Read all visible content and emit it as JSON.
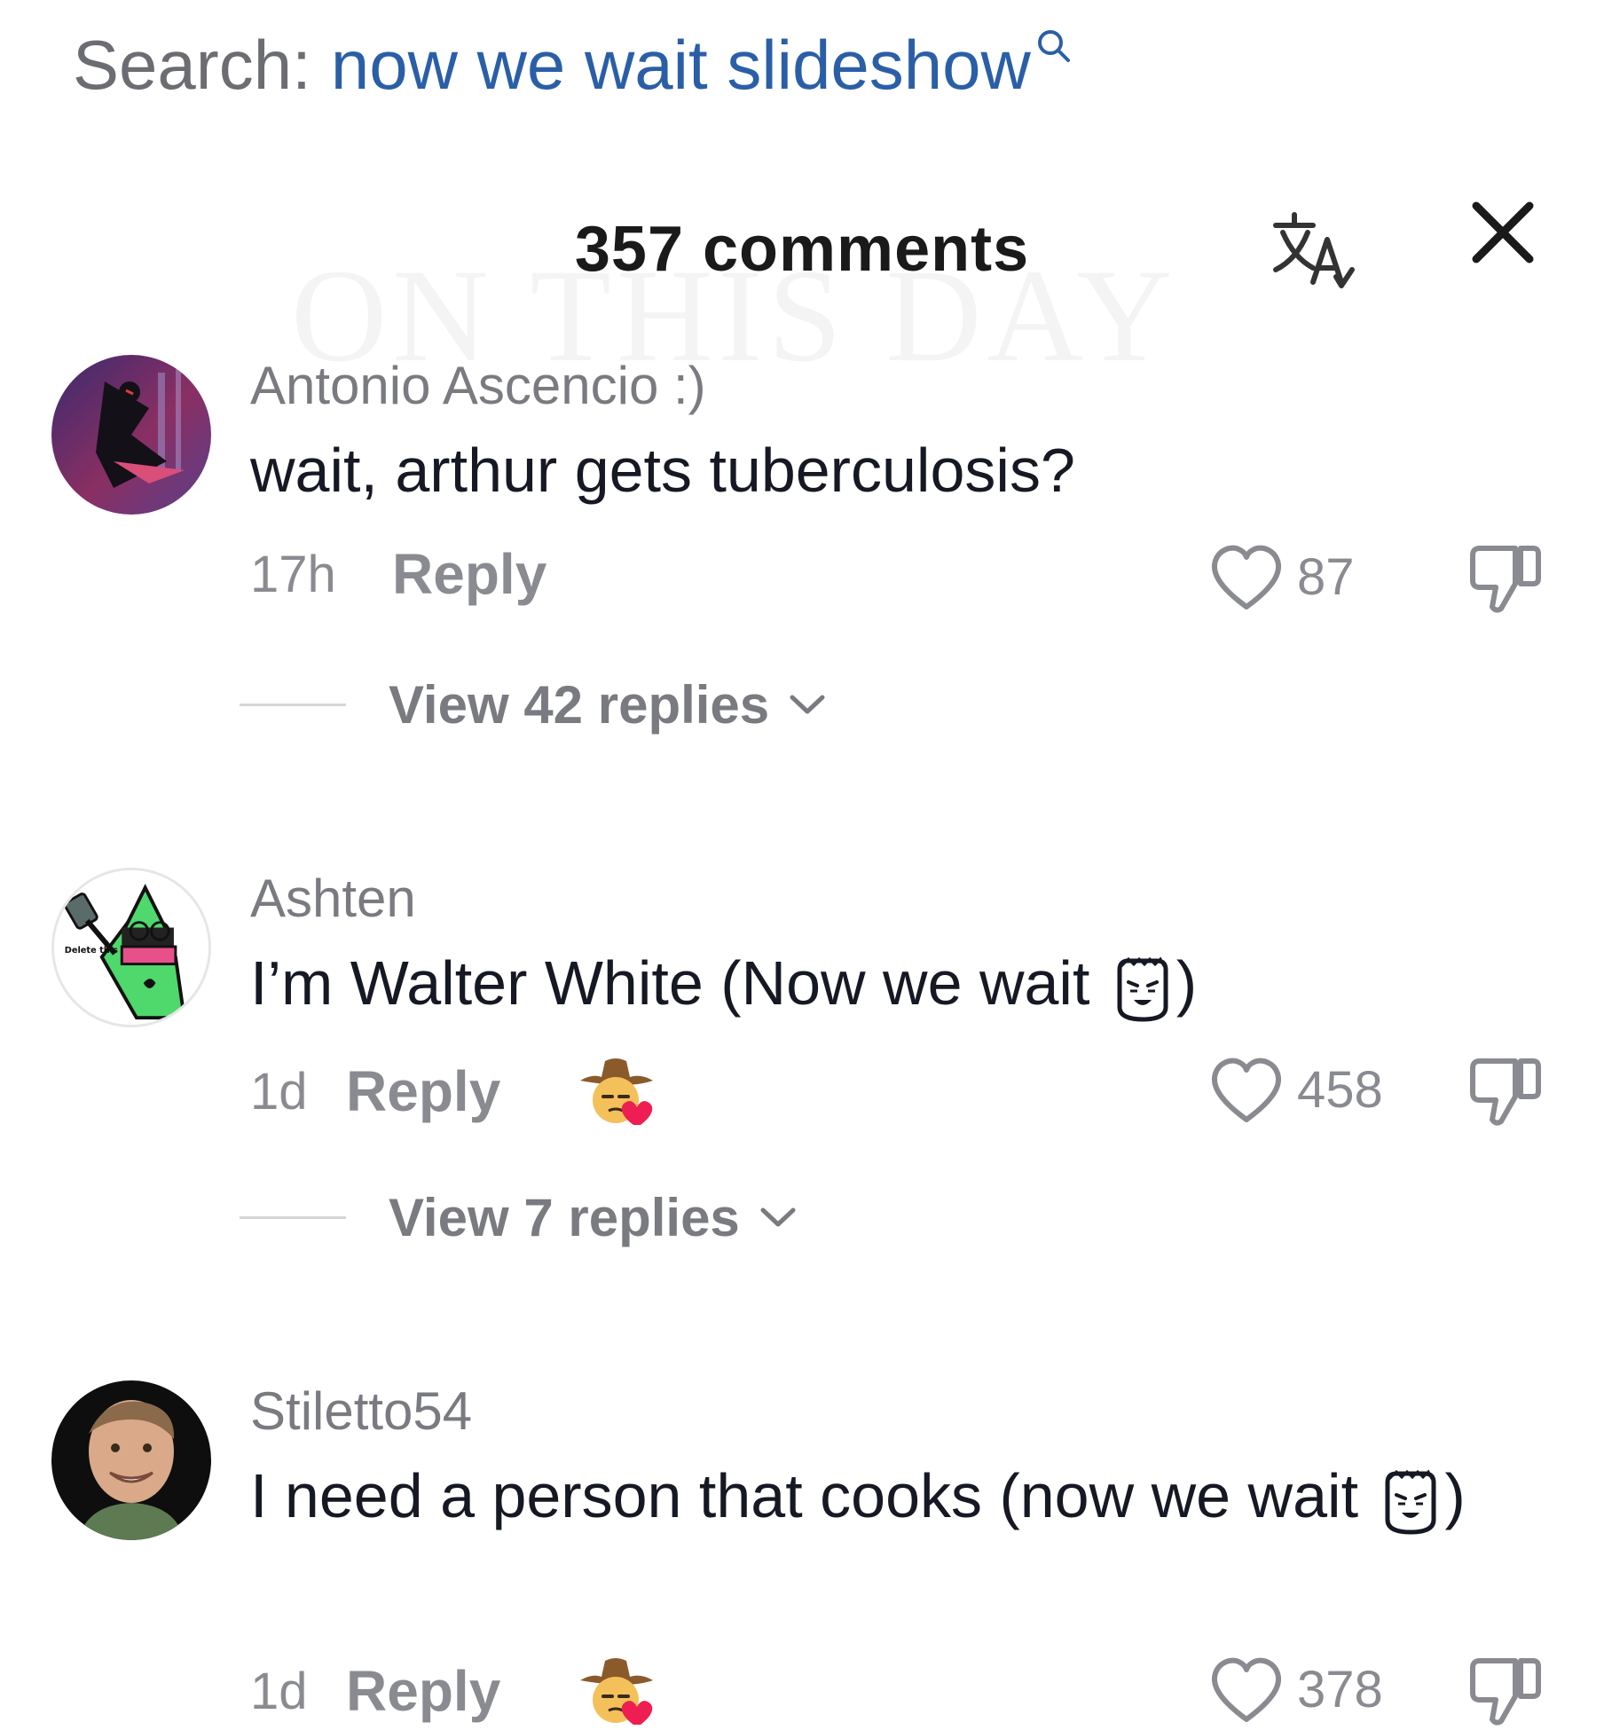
{
  "search": {
    "label": "Search:",
    "query": "now we wait slideshow"
  },
  "header": {
    "comment_count": "357 comments"
  },
  "watermark": "ON THIS DAY",
  "comments": [
    {
      "username": "Antonio Ascencio :)",
      "text": "wait, arthur gets tuberculosis?",
      "time": "17h",
      "reply_label": "Reply",
      "likes": "87",
      "view_replies": "View 42 replies"
    },
    {
      "username": "Ashten",
      "text": "I’m Walter White (Now we wait ",
      "text_end": ")",
      "time": "1d",
      "reply_label": "Reply",
      "likes": "458",
      "view_replies": "View 7 replies",
      "avatar_caption": "Delete this"
    },
    {
      "username": "Stiletto54",
      "text": "I need a person that cooks (now we wait ",
      "text_end": ")",
      "time": "1d",
      "reply_label": "Reply",
      "likes": "378"
    }
  ],
  "colors": {
    "search_query": "#2a5fa7",
    "muted": "#8a8b91",
    "heart_red": "#ee1d52"
  }
}
